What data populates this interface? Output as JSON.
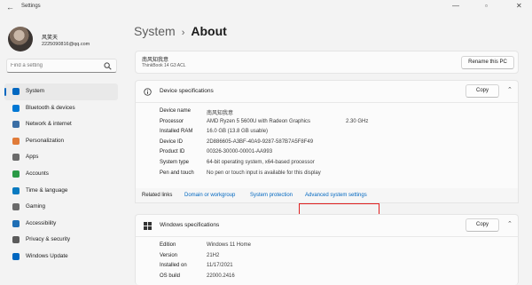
{
  "window": {
    "back_glyph": "←",
    "title": "Settings",
    "minimize_glyph": "—",
    "maximize_glyph": "▫",
    "close_glyph": "✕"
  },
  "profile": {
    "name": "风笑天",
    "email": "2225090816@qq.com"
  },
  "search": {
    "placeholder": "Find a setting"
  },
  "sidebar": {
    "items": [
      {
        "label": "System",
        "icon": "system-icon",
        "color": "#0067c0",
        "active": true
      },
      {
        "label": "Bluetooth & devices",
        "icon": "bluetooth-icon",
        "color": "#0078d4"
      },
      {
        "label": "Network & internet",
        "icon": "network-icon",
        "color": "#3a6ea5"
      },
      {
        "label": "Personalization",
        "icon": "brush-icon",
        "color": "#e07b39"
      },
      {
        "label": "Apps",
        "icon": "apps-icon",
        "color": "#6b6b6b"
      },
      {
        "label": "Accounts",
        "icon": "accounts-icon",
        "color": "#2b9a46"
      },
      {
        "label": "Time & language",
        "icon": "globe-clock-icon",
        "color": "#0a7ac0"
      },
      {
        "label": "Gaming",
        "icon": "gamepad-icon",
        "color": "#6b6b6b"
      },
      {
        "label": "Accessibility",
        "icon": "accessibility-icon",
        "color": "#1f6fb5"
      },
      {
        "label": "Privacy & security",
        "icon": "shield-icon",
        "color": "#5b5b5b"
      },
      {
        "label": "Windows Update",
        "icon": "update-icon",
        "color": "#0067c0"
      }
    ]
  },
  "breadcrumb": {
    "parent": "System",
    "separator": "›",
    "current": "About"
  },
  "device_card": {
    "name": "南风知我意",
    "model": "ThinkBook 14 G3 ACL",
    "rename_label": "Rename this PC"
  },
  "device_specs": {
    "title": "Device specifications",
    "copy_label": "Copy",
    "rows": [
      {
        "label": "Device name",
        "value": "南风知我意",
        "extra": ""
      },
      {
        "label": "Processor",
        "value": "AMD Ryzen 5 5600U with Radeon Graphics",
        "extra": "2.30 GHz"
      },
      {
        "label": "Installed RAM",
        "value": "16.0 GB (13.8 GB usable)",
        "extra": ""
      },
      {
        "label": "Device ID",
        "value": "2D886605-A3BF-40A9-9287-587B7A5F8F49",
        "extra": ""
      },
      {
        "label": "Product ID",
        "value": "00326-30000-00001-AA993",
        "extra": ""
      },
      {
        "label": "System type",
        "value": "64-bit operating system, x64-based processor",
        "extra": ""
      },
      {
        "label": "Pen and touch",
        "value": "No pen or touch input is available for this display",
        "extra": ""
      }
    ]
  },
  "related_links": {
    "label": "Related links",
    "links": [
      "Domain or workgroup",
      "System protection",
      "Advanced system settings"
    ]
  },
  "windows_specs": {
    "title": "Windows specifications",
    "copy_label": "Copy",
    "rows": [
      {
        "label": "Edition",
        "value": "Windows 11 Home"
      },
      {
        "label": "Version",
        "value": "21H2"
      },
      {
        "label": "Installed on",
        "value": "11/17/2021"
      },
      {
        "label": "OS build",
        "value": "22000.2416"
      }
    ]
  }
}
